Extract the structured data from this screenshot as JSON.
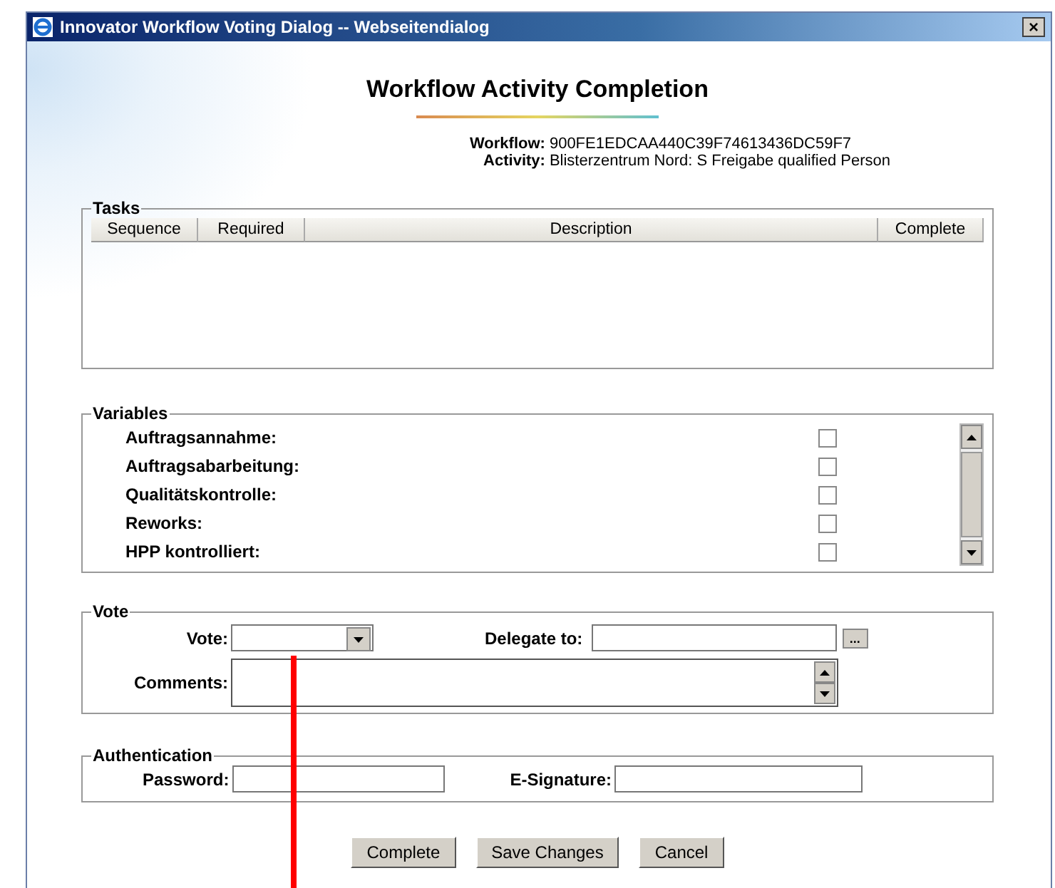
{
  "window": {
    "title": "Innovator Workflow Voting Dialog -- Webseitendialog",
    "close": "×"
  },
  "heading": "Workflow Activity Completion",
  "info": [
    {
      "label": "Workflow:",
      "value": "900FE1EDCAA440C39F74613436DC59F7"
    },
    {
      "label": "Activity:",
      "value": "Blisterzentrum Nord: S Freigabe qualified Person"
    }
  ],
  "tasks": {
    "legend": "Tasks",
    "columns": [
      "Sequence",
      "Required",
      "Description",
      "Complete"
    ]
  },
  "variables": {
    "legend": "Variables",
    "items": [
      {
        "label": "Auftragsannahme:",
        "checked": false
      },
      {
        "label": "Auftragsabarbeitung:",
        "checked": false
      },
      {
        "label": "Qualitätskontrolle:",
        "checked": false
      },
      {
        "label": "Reworks:",
        "checked": false
      },
      {
        "label": "HPP kontrolliert:",
        "checked": false
      }
    ]
  },
  "vote": {
    "legend": "Vote",
    "vote_label": "Vote:",
    "delegate_label": "Delegate to:",
    "delegate_button": "...",
    "comments_label": "Comments:"
  },
  "authentication": {
    "legend": "Authentication",
    "password_label": "Password:",
    "signature_label": "E-Signature:"
  },
  "buttons": [
    "Complete",
    "Save Changes",
    "Cancel"
  ]
}
